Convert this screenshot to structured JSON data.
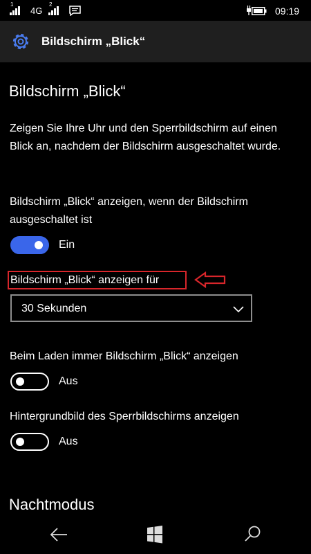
{
  "status_bar": {
    "network_type": "4G",
    "sim1_number": "1",
    "sim2_number": "2",
    "time": "09:19",
    "icons": [
      "signal-icon",
      "signal-icon",
      "message-icon",
      "charging-plug-icon",
      "battery-icon"
    ]
  },
  "header": {
    "icon": "gear-icon",
    "title": "Bildschirm „Blick“"
  },
  "page": {
    "title": "Bildschirm „Blick“",
    "description": "Zeigen Sie Ihre Uhr und den Sperrbildschirm auf einen Blick an, nachdem der Bildschirm ausgeschaltet wurde."
  },
  "settings": {
    "glance_off": {
      "label": "Bildschirm „Blick“ anzeigen, wenn der Bildschirm ausgeschaltet ist",
      "state": "Ein",
      "on": true
    },
    "duration": {
      "label": "Bildschirm „Blick“ anzeigen für",
      "value": "30 Sekunden"
    },
    "charging": {
      "label": "Beim Laden immer Bildschirm „Blick“ anzeigen",
      "state": "Aus",
      "on": false
    },
    "wallpaper": {
      "label": "Hintergrundbild des Sperrbildschirms anzeigen",
      "state": "Aus",
      "on": false
    }
  },
  "night_mode": {
    "title": "Nachtmodus"
  },
  "nav_bar": {
    "icons": [
      "back-arrow-icon",
      "windows-start-icon",
      "search-icon"
    ]
  },
  "colors": {
    "accent": "#3a66ea",
    "highlight": "#d8262b",
    "header_bg": "#1f1f1f",
    "background": "#000000"
  }
}
